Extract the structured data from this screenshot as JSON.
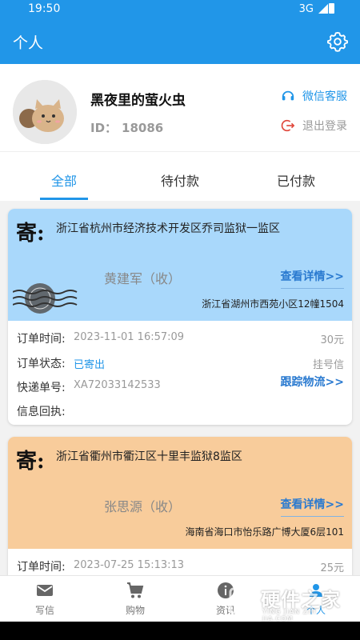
{
  "status_bar": {
    "time": "19:50",
    "network": "3G"
  },
  "app_bar": {
    "title": "个人",
    "settings_icon": "gear-icon"
  },
  "profile": {
    "nickname": "黑夜里的萤火虫",
    "id_label": "ID：",
    "id_value": "18086",
    "service_label": "微信客服",
    "logout_label": "退出登录"
  },
  "tabs": [
    {
      "label": "全部",
      "active": true
    },
    {
      "label": "待付款",
      "active": false
    },
    {
      "label": "已付款",
      "active": false
    }
  ],
  "orders": [
    {
      "ji": "寄:",
      "from": "浙江省杭州市经济技术开发区乔司监狱一监区",
      "receiver": "黄建军（收）",
      "detail_link": "查看详情>>",
      "to": "浙江省湖州市西苑小区12幢1504",
      "color": "#a9d8fb",
      "order_time_label": "订单时间:",
      "order_time": "2023-11-01 16:57:09",
      "price": "30元",
      "status_label": "订单状态:",
      "status": "已寄出",
      "mail_type": "挂号信",
      "tracking_label": "快递单号:",
      "tracking": "XA72033142533",
      "track_link": "跟踪物流>>",
      "receipt_label": "信息回执:"
    },
    {
      "ji": "寄:",
      "from": "浙江省衢州市衢江区十里丰监狱8监区",
      "receiver": "张思源（收）",
      "detail_link": "查看详情>>",
      "to": "海南省海口市怡乐路广博大厦6层101",
      "color": "#f8cc9b",
      "order_time_label": "订单时间:",
      "order_time": "2023-07-25 15:13:13",
      "price": "25元"
    }
  ],
  "bottom_nav": [
    {
      "label": "写信",
      "icon": "mail-icon"
    },
    {
      "label": "购物",
      "icon": "cart-icon"
    },
    {
      "label": "资讯",
      "icon": "info-icon"
    },
    {
      "label": "个人",
      "icon": "person-icon",
      "active": true
    }
  ],
  "watermark": {
    "text": "硬件之家",
    "sub": "YING JIAN ZHI JIA.COM"
  },
  "colors": {
    "primary": "#2196e8",
    "link": "#2a7ad0"
  }
}
